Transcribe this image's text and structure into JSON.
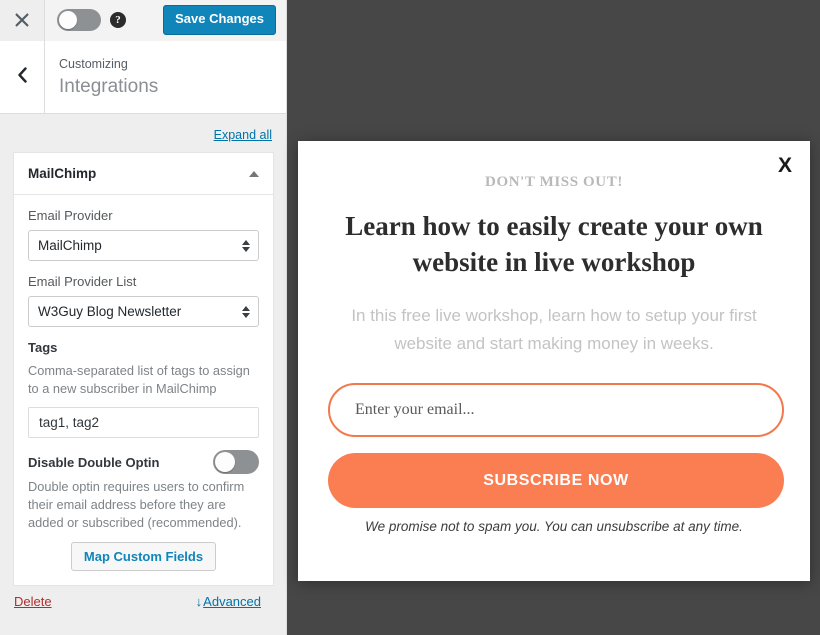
{
  "customizer": {
    "topbar": {
      "close_icon": "close-icon",
      "device_toggle_state": "off",
      "help_icon_label": "?",
      "save_label": "Save Changes"
    },
    "header": {
      "back_icon": "chevron-left-icon",
      "eyebrow": "Customizing",
      "title": "Integrations"
    },
    "expand_all_label": "Expand all",
    "panel": {
      "title": "MailChimp",
      "collapse_icon": "caret-up-icon",
      "fields": {
        "email_provider_label": "Email Provider",
        "email_provider_value": "MailChimp",
        "email_provider_list_label": "Email Provider List",
        "email_provider_list_value": "W3Guy Blog Newsletter",
        "tags_label": "Tags",
        "tags_help": "Comma-separated list of tags to assign to a new subscriber in MailChimp",
        "tags_value": "tag1, tag2",
        "disable_double_optin_label": "Disable Double Optin",
        "disable_double_optin_state": "off",
        "double_optin_help": "Double optin requires users to confirm their email address before they are added or subscribed (recommended).",
        "map_custom_fields_label": "Map Custom Fields"
      },
      "footer": {
        "delete_label": "Delete",
        "advanced_arrow": "↓",
        "advanced_label": "Advanced"
      }
    },
    "colors": {
      "accent_blue": "#0f85ba",
      "delete_red": "#b32d2e",
      "link_blue": "#0073aa",
      "panel_bg": "#eeeeee"
    }
  },
  "preview": {
    "background_color": "#474747",
    "modal": {
      "close_label": "X",
      "kicker": "DON'T MISS OUT!",
      "headline": "Learn how to easily create your own website in live workshop",
      "subtext": "In this free live workshop, learn how to setup your first website and start making money in weeks.",
      "email_placeholder": "Enter your email...",
      "email_value": "",
      "submit_label": "SUBSCRIBE NOW",
      "disclaimer": "We promise not to spam you. You can unsubscribe at any time.",
      "accent_orange": "#fb7d52"
    }
  }
}
